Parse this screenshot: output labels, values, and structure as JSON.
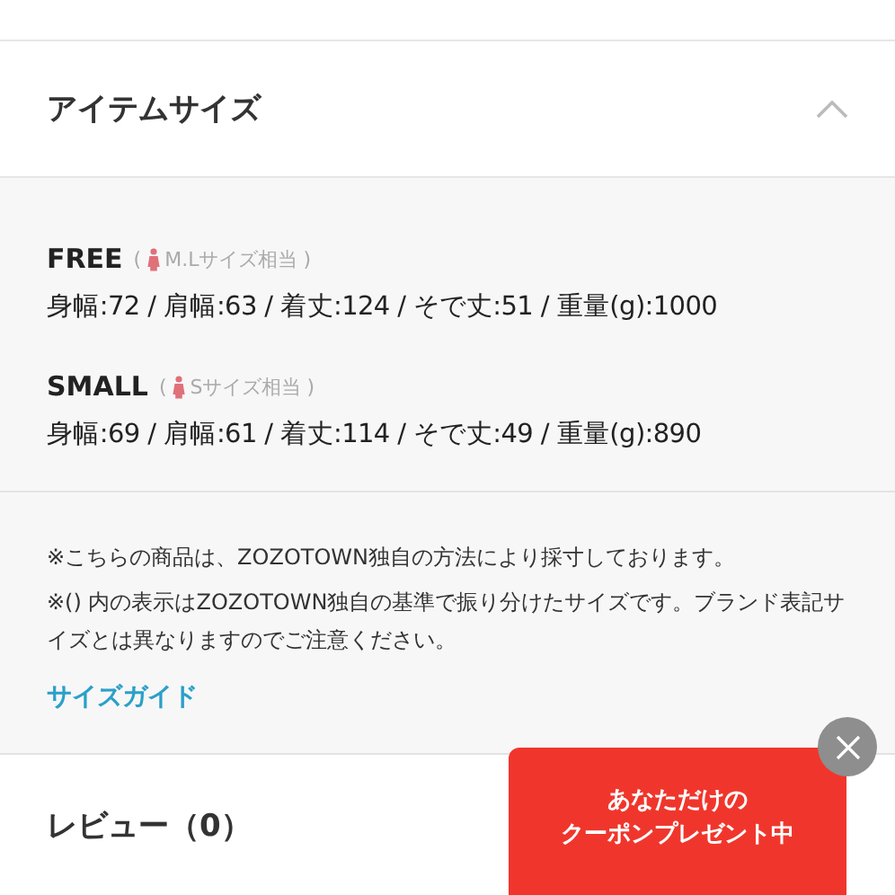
{
  "section": {
    "title": "アイテムサイズ",
    "expanded": true
  },
  "sizes": [
    {
      "name": "FREE",
      "paren_open": "(",
      "equivalent": "M.Lサイズ相当",
      "paren_close": ")",
      "measurements": "身幅:72 / 肩幅:63 / 着丈:124 / そで丈:51 / 重量(g):1000"
    },
    {
      "name": "SMALL",
      "paren_open": "(",
      "equivalent": "Sサイズ相当",
      "paren_close": ")",
      "measurements": "身幅:69 / 肩幅:61 / 着丈:114 / そで丈:49 / 重量(g):890"
    }
  ],
  "notes": [
    "※こちらの商品は、ZOZOTOWN独自の方法により採寸しております。",
    "※() 内の表示はZOZOTOWN独自の基準で振り分けたサイズです。ブランド表記サイズとは異なりますのでご注意ください。"
  ],
  "size_guide_link": "サイズガイド",
  "reviews": {
    "title": "レビュー（0）"
  },
  "coupon_popup": {
    "lines": [
      "あなただけの",
      "クーポンプレゼント中"
    ]
  }
}
